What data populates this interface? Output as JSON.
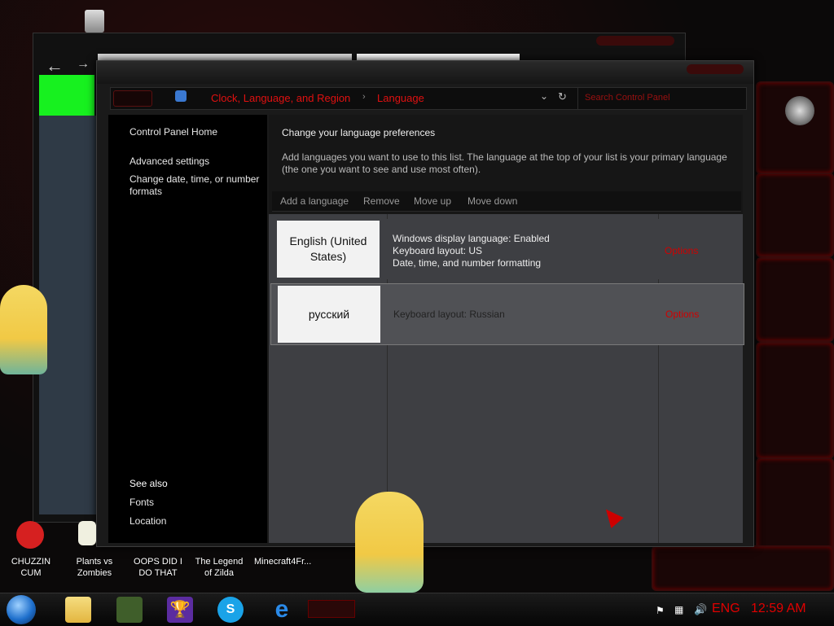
{
  "window": {
    "breadcrumb": [
      "Clock, Language, and Region",
      "Language"
    ],
    "search_placeholder": "Search Control Panel"
  },
  "sidebar": {
    "links": [
      "Control Panel Home",
      "Advanced settings",
      "Change date, time, or number formats"
    ],
    "see_also_title": "See also",
    "see_also_links": [
      "Fonts",
      "Location"
    ]
  },
  "main": {
    "heading": "Change your language preferences",
    "description": "Add languages you want to use to this list. The language at the top of your list is your primary language (the one you want to see and use most often).",
    "toolbar": [
      "Add a language",
      "Remove",
      "Move up",
      "Move down"
    ],
    "languages": [
      {
        "name": "English (United States)",
        "info": [
          "Windows display language: Enabled",
          "Keyboard layout: US",
          "Date, time, and number formatting"
        ],
        "options": "Options"
      },
      {
        "name": "русский",
        "info": [
          "Keyboard layout: Russian"
        ],
        "options": "Options"
      }
    ]
  },
  "desktop_icons": [
    {
      "label": "CHUZZIN CUM",
      "icon": "chuzzle-icon"
    },
    {
      "label": "Plants vs Zombies",
      "icon": "pvz-icon"
    },
    {
      "label": "OOPS DID I DO THAT",
      "icon": "oops-icon"
    },
    {
      "label": "The Legend of Zilda",
      "icon": "zelda-icon"
    },
    {
      "label": "Minecraft4Fr...",
      "icon": "minecraft-icon"
    }
  ],
  "taskbar": {
    "language": "ENG",
    "time": "12:59 AM"
  },
  "colors": {
    "accent": "#e01010",
    "tile": "#f2f2f2"
  }
}
